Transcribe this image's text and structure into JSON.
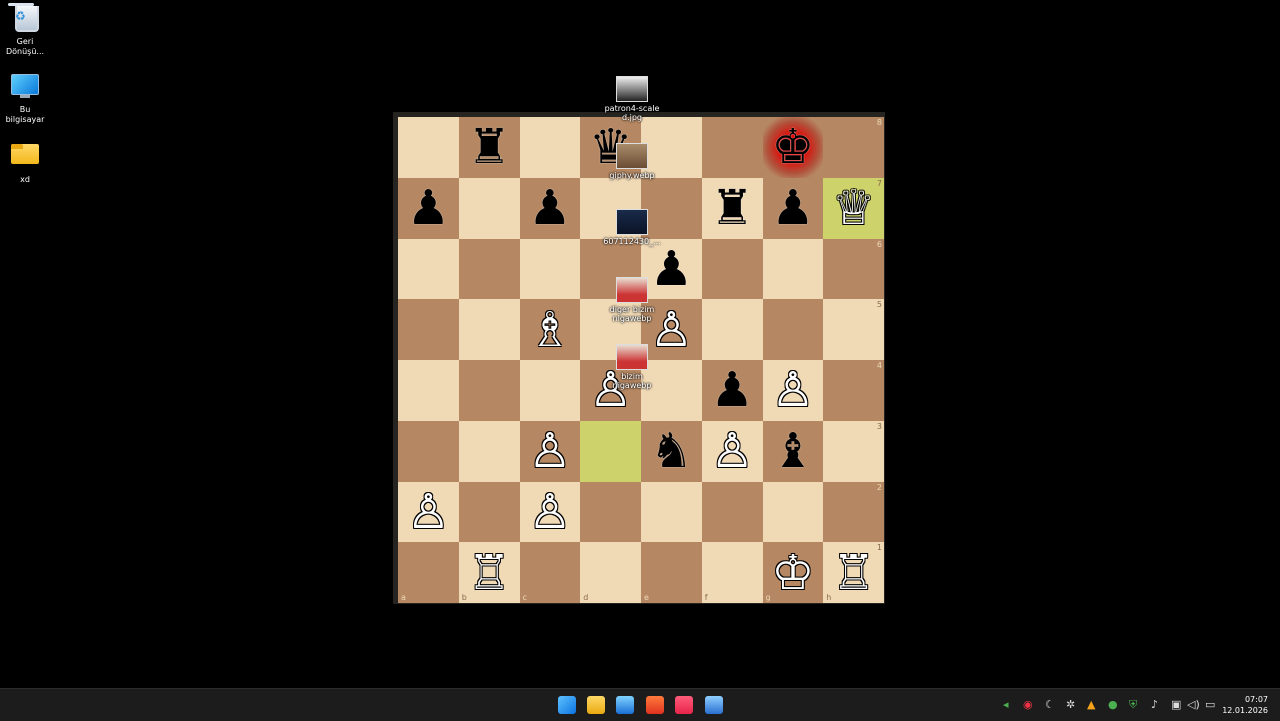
{
  "desktop_icons": [
    {
      "label": "Geri\nDönüşü...",
      "icon": "recycle-bin-icon"
    },
    {
      "label": "Bu bilgisayar",
      "icon": "computer-icon"
    },
    {
      "label": "xd",
      "icon": "folder-icon"
    }
  ],
  "file_icons": [
    {
      "label": "patron4-scale\nd.jpg"
    },
    {
      "label": "giphy.webp"
    },
    {
      "label": "607112430_..."
    },
    {
      "label": "diger bizim\nnigawebp"
    },
    {
      "label": "bizim\nnigawebp"
    }
  ],
  "board": {
    "ranks": [
      "8",
      "7",
      "6",
      "5",
      "4",
      "3",
      "2",
      "1"
    ],
    "files": [
      "a",
      "b",
      "c",
      "d",
      "e",
      "f",
      "g",
      "h"
    ],
    "pieces": {
      "b8": {
        "glyph": "♜",
        "side": "b"
      },
      "d8": {
        "glyph": "♛",
        "side": "b"
      },
      "g8": {
        "glyph": "♚",
        "side": "b"
      },
      "a7": {
        "glyph": "♟",
        "side": "b"
      },
      "c7": {
        "glyph": "♟",
        "side": "b"
      },
      "f7": {
        "glyph": "♜",
        "side": "b"
      },
      "g7": {
        "glyph": "♟",
        "side": "b"
      },
      "h7": {
        "glyph": "♕",
        "side": "w"
      },
      "e6": {
        "glyph": "♟",
        "side": "b"
      },
      "c5": {
        "glyph": "♗",
        "side": "w"
      },
      "e5": {
        "glyph": "♙",
        "side": "w"
      },
      "d4": {
        "glyph": "♙",
        "side": "w"
      },
      "f4": {
        "glyph": "♟",
        "side": "b"
      },
      "g4": {
        "glyph": "♙",
        "side": "w"
      },
      "c3": {
        "glyph": "♙",
        "side": "w"
      },
      "e3": {
        "glyph": "♞",
        "side": "b"
      },
      "f3": {
        "glyph": "♙",
        "side": "w"
      },
      "g3": {
        "glyph": "♝",
        "side": "b"
      },
      "a2": {
        "glyph": "♙",
        "side": "w"
      },
      "c2": {
        "glyph": "♙",
        "side": "w"
      },
      "b1": {
        "glyph": "♖",
        "side": "w"
      },
      "g1": {
        "glyph": "♔",
        "side": "w"
      },
      "h1": {
        "glyph": "♖",
        "side": "w"
      }
    },
    "highlighted": [
      "h7",
      "d3"
    ],
    "check": "g8"
  },
  "taskbar": {
    "apps": [
      "windows-start-icon",
      "file-explorer-icon",
      "store-icon",
      "brave-browser-icon",
      "music-app-icon",
      "app-icon"
    ],
    "clock_time": "07:07",
    "clock_date": "12.01.2026"
  }
}
